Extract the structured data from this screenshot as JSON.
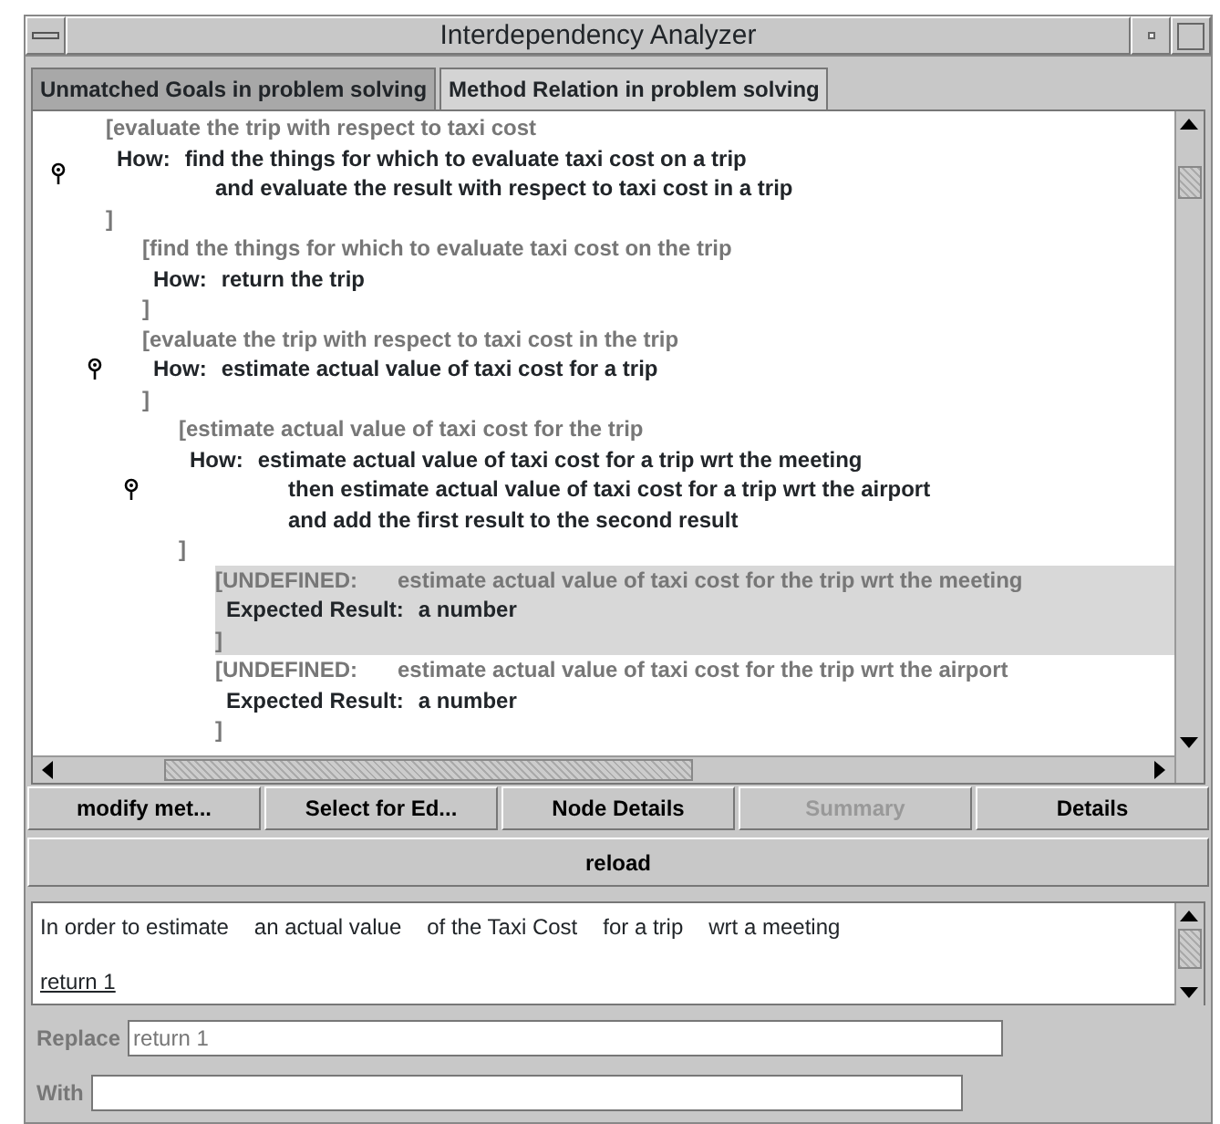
{
  "window": {
    "title": "Interdependency Analyzer"
  },
  "tabs": [
    {
      "label": "Unmatched Goals in problem solving",
      "selected": false
    },
    {
      "label": "Method Relation in problem solving",
      "selected": true
    }
  ],
  "tree": [
    {
      "kind": "method",
      "title": "[evaluate the trip with respect to taxi cost",
      "label": "How:",
      "lines": [
        "find the things for which to evaluate taxi cost on a trip",
        "and evaluate the result with respect to taxi cost in a trip"
      ],
      "close": "]",
      "pinned": true,
      "highlighted": false,
      "children": [
        {
          "kind": "method",
          "title": "[find the things for which to evaluate taxi cost on the trip",
          "label": "How:",
          "lines": [
            "return the trip"
          ],
          "close": "]",
          "pinned": false,
          "highlighted": false
        },
        {
          "kind": "method",
          "title": "[evaluate the trip with respect to taxi cost in the trip",
          "label": "How:",
          "lines": [
            "estimate actual value of taxi cost for a trip"
          ],
          "close": "]",
          "pinned": true,
          "highlighted": false,
          "children": [
            {
              "kind": "method",
              "title": "[estimate actual value of taxi cost for the trip",
              "label": "How:",
              "lines": [
                "estimate actual value of taxi cost for a trip wrt the meeting",
                "then estimate actual value of taxi cost for a trip wrt the airport",
                "and add the first result to the second result"
              ],
              "close": "]",
              "pinned": true,
              "highlighted": false,
              "children": [
                {
                  "kind": "undefined",
                  "tag": "[UNDEFINED:",
                  "title": "estimate actual value of taxi cost for the trip wrt the meeting",
                  "label": "Expected Result:",
                  "lines": [
                    "a number"
                  ],
                  "close": "]",
                  "pinned": false,
                  "highlighted": true
                },
                {
                  "kind": "undefined",
                  "tag": "[UNDEFINED:",
                  "title": "estimate actual value of taxi cost for the trip wrt the airport",
                  "label": "Expected Result:",
                  "lines": [
                    "a number"
                  ],
                  "close": "]",
                  "pinned": false,
                  "highlighted": false
                }
              ]
            }
          ]
        }
      ]
    }
  ],
  "buttons": [
    {
      "label": "modify met...",
      "disabled": false
    },
    {
      "label": "Select for Ed...",
      "disabled": false
    },
    {
      "label": "Node Details",
      "disabled": false
    },
    {
      "label": "Summary",
      "disabled": true
    },
    {
      "label": "Details",
      "disabled": false
    }
  ],
  "reload_button": "reload",
  "sentence": [
    "In order to estimate",
    "an actual value",
    "of the Taxi Cost",
    "for a trip",
    "wrt a meeting"
  ],
  "link": "return 1",
  "fields": [
    {
      "label": "Replace",
      "value": "return 1",
      "disabled": true
    },
    {
      "label": "With",
      "disabled": true
    }
  ]
}
